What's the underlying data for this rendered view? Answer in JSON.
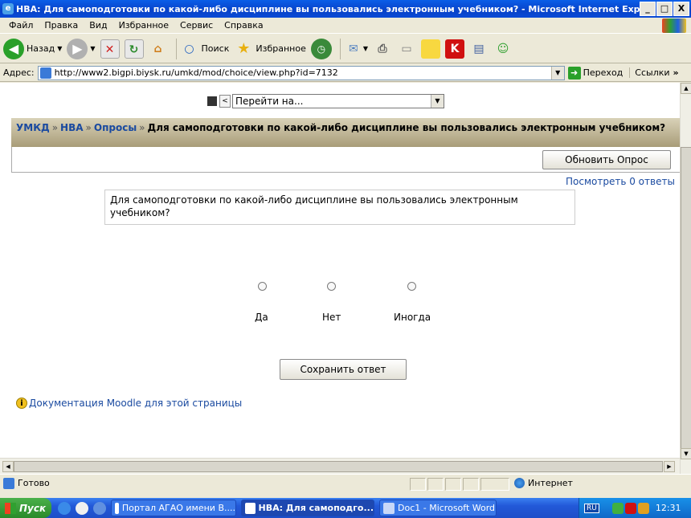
{
  "window": {
    "title": "НВА: Для самоподготовки по какой-либо дисциплине вы пользовались электронным учебником? - Microsoft Internet Expl...",
    "minimize": "_",
    "maximize": "□",
    "close": "X"
  },
  "menu": [
    "Файл",
    "Правка",
    "Вид",
    "Избранное",
    "Сервис",
    "Справка"
  ],
  "toolbar": {
    "back_label": "Назад",
    "search_label": "Поиск",
    "favorites_label": "Избранное"
  },
  "address": {
    "label": "Адрес:",
    "url": "http://www2.bigpi.biysk.ru/umkd/mod/choice/view.php?id=7132",
    "go_label": "Переход",
    "links_label": "Ссылки"
  },
  "page": {
    "jump_prev": "<",
    "jump_placeholder": "Перейти на...",
    "breadcrumb": {
      "items": [
        "УМКД",
        "НВА",
        "Опросы"
      ],
      "sep": "»",
      "current": "Для самоподготовки по какой-либо дисциплине вы пользовались электронным учебником?"
    },
    "update_button": "Обновить Опрос",
    "view_answers_link": "Посмотреть 0 ответы",
    "question": "Для самоподготовки по какой-либо дисциплине вы пользовались электронным учебником?",
    "options": [
      "Да",
      "Нет",
      "Иногда"
    ],
    "save_button": "Сохранить ответ",
    "docs_link": "Документация Moodle для этой страницы"
  },
  "status": {
    "text": "Готово",
    "zone": "Интернет"
  },
  "taskbar": {
    "start": "Пуск",
    "tasks": [
      {
        "label": "Портал АГАО имени В....",
        "active": false
      },
      {
        "label": "НВА: Для самоподго...",
        "active": true
      },
      {
        "label": "Doc1 - Microsoft Word",
        "active": false
      }
    ],
    "lang": "RU",
    "clock": "12:31"
  }
}
